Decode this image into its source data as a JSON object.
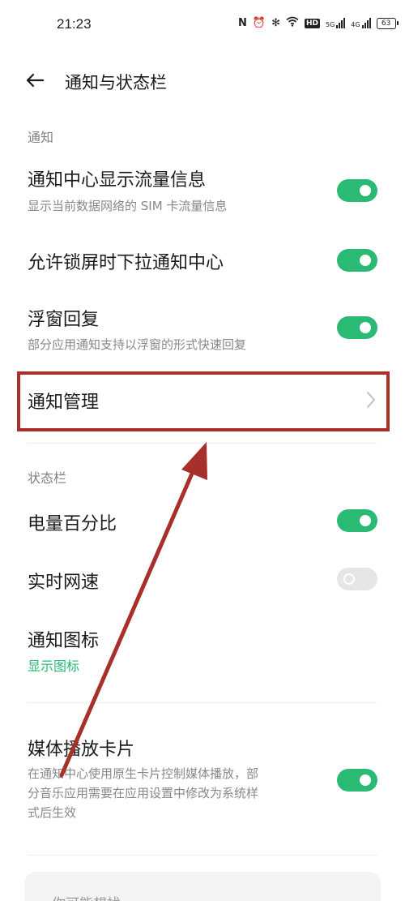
{
  "status_bar": {
    "time": "21:23",
    "nfc": "N",
    "alarm": "⏰",
    "bluetooth": "✻",
    "hd": "HD",
    "net1": "5G",
    "net2": "4G",
    "battery": "63"
  },
  "header": {
    "title": "通知与状态栏"
  },
  "sections": {
    "notification": {
      "title": "通知",
      "items": [
        {
          "title": "通知中心显示流量信息",
          "subtitle": "显示当前数据网络的 SIM 卡流量信息",
          "toggle_on": true
        },
        {
          "title": "允许锁屏时下拉通知中心",
          "toggle_on": true
        },
        {
          "title": "浮窗回复",
          "subtitle": "部分应用通知支持以浮窗的形式快速回复",
          "toggle_on": true
        },
        {
          "title": "通知管理"
        }
      ]
    },
    "status_bar": {
      "title": "状态栏",
      "items": [
        {
          "title": "电量百分比",
          "toggle_on": true
        },
        {
          "title": "实时网速",
          "toggle_on": false
        },
        {
          "title": "通知图标",
          "subtitle": "显示图标"
        }
      ]
    },
    "media": {
      "title": "媒体播放卡片",
      "subtitle_lines": [
        "在通知中心使用原生卡片控制媒体播放，部",
        "分音乐应用需要在应用设置中修改为系统样",
        "式后生效"
      ],
      "toggle_on": true
    }
  },
  "bottom_card": {
    "text": "你可能想找"
  },
  "colors": {
    "accent_green": "#2aba73",
    "annotation_red": "#a8302b"
  }
}
